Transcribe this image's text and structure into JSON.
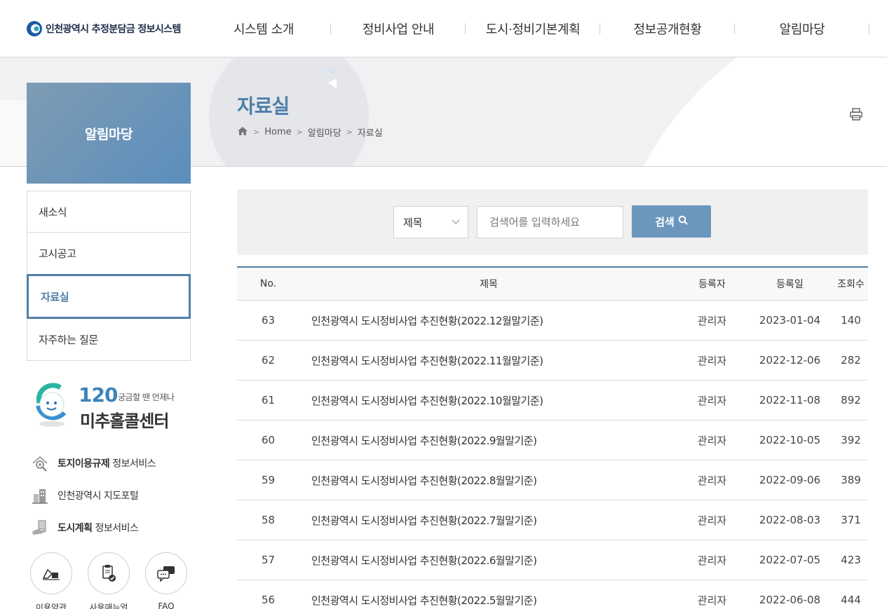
{
  "header": {
    "logo_text": "인천광역시 추정분담금 정보시스템",
    "nav": [
      "시스템 소개",
      "정비사업 안내",
      "도시·정비기본계획",
      "정보공개현황",
      "알림마당"
    ]
  },
  "side": {
    "title": "알림마당",
    "menu": [
      "새소식",
      "고시공고",
      "자료실",
      "자주하는 질문"
    ],
    "active_index": 2,
    "callcenter": {
      "number": "120",
      "tagline": "궁금할 땐 언제나",
      "name": "미추홀콜센터"
    },
    "links": [
      {
        "bold": "토지이용규제",
        "rest": "정보서비스"
      },
      {
        "bold": "",
        "rest": "인천광역시 지도포털"
      },
      {
        "bold": "도시계획",
        "rest": "정보서비스"
      }
    ],
    "circle_buttons": [
      "이용약관",
      "사용매뉴얼",
      "FAQ"
    ]
  },
  "page": {
    "title": "자료실",
    "breadcrumb": [
      "Home",
      "알림마당",
      "자료실"
    ]
  },
  "search": {
    "select_value": "제목",
    "placeholder": "검색어를 입력하세요",
    "button_label": "검색"
  },
  "table": {
    "headers": [
      "No.",
      "제목",
      "등록자",
      "등록일",
      "조회수"
    ],
    "rows": [
      {
        "no": "63",
        "title": "인천광역시 도시정비사업 추진현황(2022.12월말기준)",
        "writer": "관리자",
        "date": "2023-01-04",
        "views": "140"
      },
      {
        "no": "62",
        "title": "인천광역시 도시정비사업 추진현황(2022.11월말기준)",
        "writer": "관리자",
        "date": "2022-12-06",
        "views": "282"
      },
      {
        "no": "61",
        "title": "인천광역시 도시정비사업 추진현황(2022.10월말기준)",
        "writer": "관리자",
        "date": "2022-11-08",
        "views": "892"
      },
      {
        "no": "60",
        "title": "인천광역시 도시정비사업 추진현황(2022.9월말기준)",
        "writer": "관리자",
        "date": "2022-10-05",
        "views": "392"
      },
      {
        "no": "59",
        "title": "인천광역시 도시정비사업 추진현황(2022.8월말기준)",
        "writer": "관리자",
        "date": "2022-09-06",
        "views": "389"
      },
      {
        "no": "58",
        "title": "인천광역시 도시정비사업 추진현황(2022.7월말기준)",
        "writer": "관리자",
        "date": "2022-08-03",
        "views": "371"
      },
      {
        "no": "57",
        "title": "인천광역시 도시정비사업 추진현황(2022.6월말기준)",
        "writer": "관리자",
        "date": "2022-07-05",
        "views": "423"
      },
      {
        "no": "56",
        "title": "인천광역시 도시정비사업 추진현황(2022.5월말기준)",
        "writer": "관리자",
        "date": "2022-06-08",
        "views": "444"
      }
    ]
  },
  "colors": {
    "accent": "#4f7fa9",
    "button": "#6c97bd",
    "side_title_from": "#7e9cb3",
    "side_title_to": "#5b8ebd"
  }
}
